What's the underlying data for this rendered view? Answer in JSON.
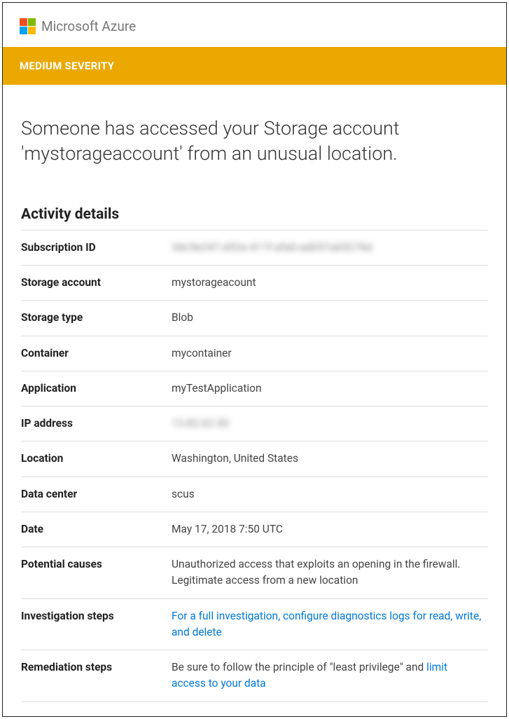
{
  "brand": "Microsoft Azure",
  "severity": "MEDIUM SEVERITY",
  "alert_title": "Someone has accessed your Storage account 'mystorageaccount' from an unusual location.",
  "details_heading": "Activity details",
  "details": {
    "subscription_id_label": "Subscription ID",
    "subscription_id_value": "3dc5e247-d52e-411f-afa0-ad057a65276d",
    "storage_account_label": "Storage account",
    "storage_account_value": "mystorageacount",
    "storage_type_label": "Storage type",
    "storage_type_value": "Blob",
    "container_label": "Container",
    "container_value": "mycontainer",
    "application_label": "Application",
    "application_value": "myTestApplication",
    "ip_label": "IP address",
    "ip_value": "13.82.62.50",
    "location_label": "Location",
    "location_value": "Washington, United States",
    "datacenter_label": "Data center",
    "datacenter_value": "scus",
    "date_label": "Date",
    "date_value": "May 17, 2018 7:50 UTC",
    "causes_label": "Potential causes",
    "causes_value": "Unauthorized access that exploits an opening in the firewall. Legitimate access from a new location",
    "investigation_label": "Investigation steps",
    "investigation_link": "For a full investigation, configure diagnostics logs for read, write, and delete",
    "remediation_label": "Remediation steps",
    "remediation_text_pre": "Be sure to follow the principle of \"least privilege\" and ",
    "remediation_link": "limit access to your data"
  }
}
